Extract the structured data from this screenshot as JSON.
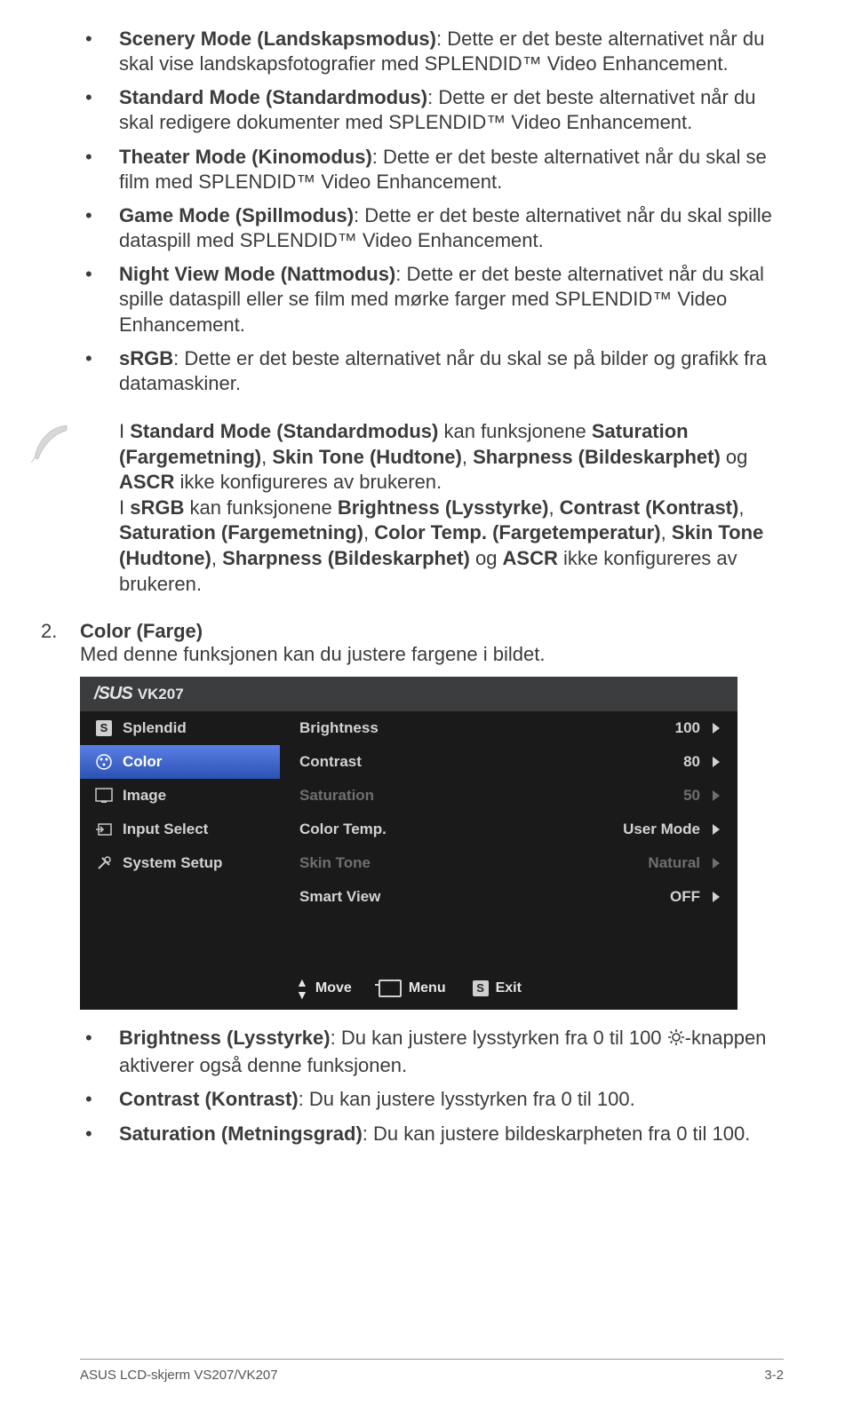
{
  "bullets_top": [
    {
      "title": "Scenery Mode (Landskapsmodus)",
      "desc": ": Dette er det beste alternativet når du skal vise landskapsfotografier med SPLENDID™ Video Enhancement."
    },
    {
      "title": "Standard Mode (Standardmodus)",
      "desc": ": Dette er det beste alternativet når du skal redigere dokumenter med SPLENDID™ Video Enhancement."
    },
    {
      "title": "Theater Mode (Kinomodus)",
      "desc": ": Dette er det beste alternativet når du skal se film med SPLENDID™ Video Enhancement."
    },
    {
      "title": "Game Mode (Spillmodus)",
      "desc": ": Dette er det beste alternativet når du skal spille dataspill med SPLENDID™ Video Enhancement."
    },
    {
      "title": "Night View Mode (Nattmodus)",
      "desc": ": Dette er det beste alternativet når du skal spille dataspill eller se film med mørke farger med SPLENDID™ Video Enhancement."
    },
    {
      "title": "sRGB",
      "desc": ": Dette er det beste alternativet når du skal se på bilder og grafikk fra datamaskiner."
    }
  ],
  "note": {
    "p1_a": "I ",
    "p1_b": "Standard Mode (Standardmodus)",
    "p1_c": " kan funksjonene ",
    "p1_d": "Saturation (Fargemetning)",
    "p1_e": ", ",
    "p1_f": "Skin Tone (Hudtone)",
    "p1_g": ", ",
    "p1_h": "Sharpness (Bildeskarphet)",
    "p1_i": " og ",
    "p1_j": "ASCR",
    "p1_k": " ikke konfigureres av brukeren.",
    "p2_a": "I ",
    "p2_b": "sRGB",
    "p2_c": " kan funksjonene ",
    "p2_d": "Brightness (Lysstyrke)",
    "p2_e": ", ",
    "p2_f": "Contrast (Kontrast)",
    "p2_g": ", ",
    "p2_h": "Saturation (Fargemetning)",
    "p2_i": ", ",
    "p2_j": "Color Temp. (Fargetemperatur)",
    "p2_k": ", ",
    "p2_l": "Skin Tone (Hudtone)",
    "p2_m": ", ",
    "p2_n": "Sharpness (Bildeskarphet)",
    "p2_o": " og ",
    "p2_p": "ASCR",
    "p2_q": " ikke konfigureres av brukeren."
  },
  "section2": {
    "num": "2.",
    "title": "Color (Farge)",
    "desc": "Med denne funksjonen kan du justere fargene i bildet."
  },
  "osd": {
    "model": "VK207",
    "cats": [
      "Splendid",
      "Color",
      "Image",
      "Input Select",
      "System Setup"
    ],
    "rows": [
      {
        "label": "Brightness",
        "value": "100",
        "dis": false
      },
      {
        "label": "Contrast",
        "value": "80",
        "dis": false
      },
      {
        "label": "Saturation",
        "value": "50",
        "dis": true
      },
      {
        "label": "Color Temp.",
        "value": "User Mode",
        "dis": false
      },
      {
        "label": "Skin Tone",
        "value": "Natural",
        "dis": true
      },
      {
        "label": "Smart View",
        "value": "OFF",
        "dis": false
      }
    ],
    "footer": {
      "move": "Move",
      "menu": "Menu",
      "exit": "Exit",
      "s": "S"
    }
  },
  "bullets_bottom": [
    {
      "title": "Brightness (Lysstyrke)",
      "desc1": ": Du kan justere lysstyrken fra 0 til 100 ",
      "desc2": "-knappen aktiverer også denne funksjonen."
    },
    {
      "title": "Contrast (Kontrast)",
      "desc1": ": Du kan justere lysstyrken fra 0 til 100."
    },
    {
      "title": "Saturation (Metningsgrad)",
      "desc1": ": Du kan justere bildeskarpheten fra 0 til 100."
    }
  ],
  "footer": {
    "left": "ASUS LCD-skjerm VS207/VK207",
    "right": "3-2"
  }
}
